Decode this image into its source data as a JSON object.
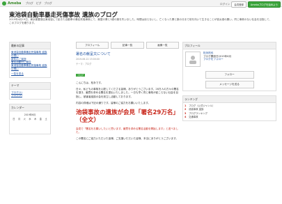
{
  "topbar": {
    "logo": "Ameba",
    "links": [
      "ブログ",
      "ピグ",
      "ブログ"
    ],
    "login_label": "ログイン",
    "register_label": "会員登録",
    "blog_button_label": "Amebaブログを始めよう"
  },
  "header": {
    "title": "東池袋自動車暴走死傷事故 遺族のブログ",
    "description": "2019年4月19日、東京都豊島区東池袋にて起きた自動車の暴走死傷事故にて、最愛の妻と3歳の娘を失いました。時間は戻らないし、亡くなった妻と娘の分まで前を向いて生きることが彼女達の願い。同じ事故のない社会を目指して、このブログを綴ります。"
  },
  "left": {
    "section1_title": "最新の記事",
    "recent_posts": [
      "東池袋自動車暴走死傷事故 遺族の想い",
      "新年のご挨拶",
      "署名活動のご報告",
      "東池袋自動車暴走死傷事故 遺族の想い"
    ],
    "more_label": "一覧を見る",
    "section2_title": "テーマ",
    "themes": [
      "ブログ(1)",
      "ブログ(1)"
    ],
    "section3_title": "カレンダー",
    "calendar_month": "2019年6月",
    "calendar_header": [
      "日",
      "月",
      "火",
      "水",
      "木",
      "金",
      "土"
    ]
  },
  "center": {
    "tabs": [
      "プロフィール",
      "記事一覧",
      "画像一覧"
    ],
    "post_title": "署名の献呈文について",
    "post_date": "2019-06-22 15:00:00",
    "post_theme": "テーマ：ブログ",
    "post_badge": "ブログ",
    "para1": "こんにちは、松永です。",
    "para2": "日々、私どもの事故を心配してくださる皆様、ありがとうございます。28万人の方々の署名を頂き、厳罰を求める署名を提出いたしました。一日も早く同じ事故が起こらない社会を目指し、被害者遺族の会を設立し活動しております。",
    "para3": "内容の詳細は下記の通りです。皆様のご協力をお願いいたします。",
    "big_title": "池袋事故の遺族が会見「署名29万名」（全文）",
    "para4": "会見で「署名をお願いしたいと思います。厳罰を求める署名活動を開始します」と述べました。",
    "para5": "この署名にご協力いただいた皆様、ご支援いただいた皆様、本当にありがとうございます。"
  },
  "right": {
    "profile_title": "プロフィール",
    "user_name": "松永拓也",
    "profile_text": "ブログ開設日2019年6月",
    "profile_link": "ブログをフォロー",
    "follow_button": "フォロー",
    "message_button": "メッセージを送る",
    "ranking_title": "ランキング",
    "ranking": [
      "ブログ（公式ジャンル）",
      "池袋事故 遺族",
      "ブログランキング",
      "交通事故"
    ]
  }
}
